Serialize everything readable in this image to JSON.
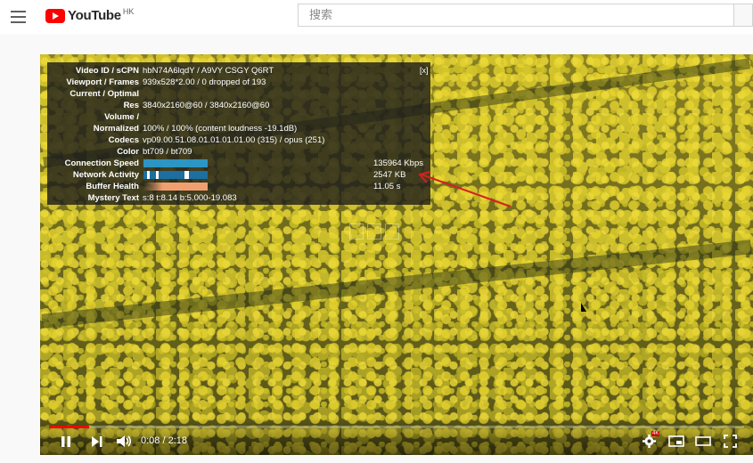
{
  "header": {
    "brand": "YouTube",
    "region": "HK",
    "search_placeholder": "搜索"
  },
  "stats": {
    "close_label": "[x]",
    "rows": [
      {
        "label": "Video ID / sCPN",
        "value": "hbN74A6lqdY / A9VY CSGY Q6RT"
      },
      {
        "label": "Viewport / Frames",
        "value": "939x528*2.00 / 0 dropped of 193"
      },
      {
        "label": "Current / Optimal",
        "value": ""
      },
      {
        "label": "Res",
        "value": "3840x2160@60 / 3840x2160@60"
      },
      {
        "label": "Volume /",
        "value": ""
      },
      {
        "label": "Normalized",
        "value": "100% / 100% (content loudness -19.1dB)"
      },
      {
        "label": "Codecs",
        "value": "vp09.00.51.08.01.01.01.01.00 (315) / opus (251)"
      },
      {
        "label": "Color",
        "value": "bt709 / bt709"
      },
      {
        "label": "Connection Speed",
        "value": "135964 Kbps"
      },
      {
        "label": "Network Activity",
        "value": "2547 KB"
      },
      {
        "label": "Buffer Health",
        "value": "11.05 s"
      },
      {
        "label": "Mystery Text",
        "value": "s:8 t:8.14 b:5.000-19.083"
      }
    ]
  },
  "player": {
    "time": "0:08 / 2:18",
    "progress_fraction": 0.058,
    "badge": "4K"
  },
  "colors": {
    "youtube_red": "#ff0000",
    "overlay_bg": "rgba(28,28,28,0.8)",
    "annotation_red": "#d62020"
  },
  "icons": [
    "menu-icon",
    "youtube-logo",
    "play-pause-icon",
    "next-icon",
    "volume-icon",
    "settings-icon",
    "miniplayer-icon",
    "theater-icon",
    "fullscreen-icon"
  ]
}
